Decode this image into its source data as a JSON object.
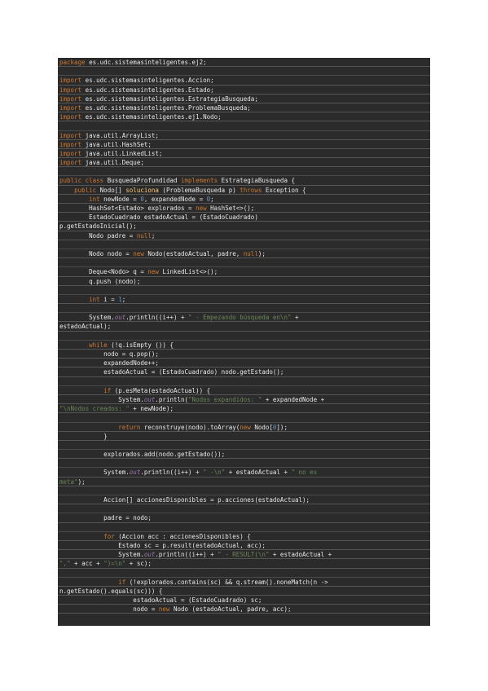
{
  "colors": {
    "background": "#2b2b2b",
    "text": "#e8e8e8",
    "keyword": "#cc7832",
    "number": "#6897bb",
    "string": "#6a8759",
    "method": "#ffc66d",
    "static_field": "#9876aa"
  },
  "code": {
    "lines": [
      [
        [
          "kw",
          "package"
        ],
        [
          "txt",
          " es.udc.sistemasinteligentes.ej2;"
        ]
      ],
      [],
      [
        [
          "kw",
          "import"
        ],
        [
          "txt",
          " es.udc.sistemasinteligentes.Accion;"
        ]
      ],
      [
        [
          "kw",
          "import"
        ],
        [
          "txt",
          " es.udc.sistemasinteligentes.Estado;"
        ]
      ],
      [
        [
          "kw",
          "import"
        ],
        [
          "txt",
          " es.udc.sistemasinteligentes.EstrategiaBusqueda;"
        ]
      ],
      [
        [
          "kw",
          "import"
        ],
        [
          "txt",
          " es.udc.sistemasinteligentes.ProblemaBusqueda;"
        ]
      ],
      [
        [
          "kw",
          "import"
        ],
        [
          "txt",
          " es.udc.sistemasinteligentes.ej1.Nodo;"
        ]
      ],
      [],
      [
        [
          "kw",
          "import"
        ],
        [
          "txt",
          " java.util.ArrayList;"
        ]
      ],
      [
        [
          "kw",
          "import"
        ],
        [
          "txt",
          " java.util.HashSet;"
        ]
      ],
      [
        [
          "kw",
          "import"
        ],
        [
          "txt",
          " java.util.LinkedList;"
        ]
      ],
      [
        [
          "kw",
          "import"
        ],
        [
          "txt",
          " java.util.Deque;"
        ]
      ],
      [],
      [
        [
          "kw",
          "public class"
        ],
        [
          "txt",
          " BusquedaProfundidad "
        ],
        [
          "kw",
          "implements"
        ],
        [
          "txt",
          " EstrategiaBusqueda {"
        ]
      ],
      [
        [
          "txt",
          "    "
        ],
        [
          "kw",
          "public"
        ],
        [
          "txt",
          " Nodo[] "
        ],
        [
          "fn",
          "soluciona"
        ],
        [
          "txt",
          " (ProblemaBusqueda p) "
        ],
        [
          "kw",
          "throws"
        ],
        [
          "txt",
          " Exception {"
        ]
      ],
      [
        [
          "txt",
          "        "
        ],
        [
          "kw",
          "int"
        ],
        [
          "txt",
          " newNode = "
        ],
        [
          "num",
          "0"
        ],
        [
          "txt",
          ", expandedNode = "
        ],
        [
          "num",
          "0"
        ],
        [
          "txt",
          ";"
        ]
      ],
      [
        [
          "txt",
          "        HashSet<Estado> explorados = "
        ],
        [
          "kw",
          "new"
        ],
        [
          "txt",
          " HashSet<>();"
        ]
      ],
      [
        [
          "txt",
          "        EstadoCuadrado estadoActual = (EstadoCuadrado)"
        ]
      ],
      [
        [
          "txt",
          "p.getEstadoInicial();"
        ]
      ],
      [
        [
          "txt",
          "        Nodo padre = "
        ],
        [
          "kw",
          "null"
        ],
        [
          "txt",
          ";"
        ]
      ],
      [],
      [
        [
          "txt",
          "        Nodo nodo = "
        ],
        [
          "kw",
          "new"
        ],
        [
          "txt",
          " Nodo(estadoActual, padre, "
        ],
        [
          "kw",
          "null"
        ],
        [
          "txt",
          ");"
        ]
      ],
      [],
      [
        [
          "txt",
          "        Deque<Nodo> q = "
        ],
        [
          "kw",
          "new"
        ],
        [
          "txt",
          " LinkedList<>();"
        ]
      ],
      [
        [
          "txt",
          "        q.push (nodo);"
        ]
      ],
      [],
      [
        [
          "txt",
          "        "
        ],
        [
          "kw",
          "int"
        ],
        [
          "txt",
          " i = "
        ],
        [
          "num",
          "1"
        ],
        [
          "txt",
          ";"
        ]
      ],
      [],
      [
        [
          "txt",
          "        System."
        ],
        [
          "fld",
          "out"
        ],
        [
          "txt",
          ".println((i++) + "
        ],
        [
          "str",
          "\" - Empezando búsqueda en\\n\""
        ],
        [
          "txt",
          " +"
        ]
      ],
      [
        [
          "txt",
          "estadoActual);"
        ]
      ],
      [],
      [
        [
          "txt",
          "        "
        ],
        [
          "kw",
          "while"
        ],
        [
          "txt",
          " (!q.isEmpty ()) {"
        ]
      ],
      [
        [
          "txt",
          "            nodo = q.pop();"
        ]
      ],
      [
        [
          "txt",
          "            expandedNode++;"
        ]
      ],
      [
        [
          "txt",
          "            estadoActual = (EstadoCuadrado) nodo.getEstado();"
        ]
      ],
      [],
      [
        [
          "txt",
          "            "
        ],
        [
          "kw",
          "if"
        ],
        [
          "txt",
          " (p.esMeta(estadoActual)) {"
        ]
      ],
      [
        [
          "txt",
          "                System."
        ],
        [
          "fld",
          "out"
        ],
        [
          "txt",
          ".println("
        ],
        [
          "str",
          "\"Nodos expandidos: \""
        ],
        [
          "txt",
          " + expandedNode +"
        ]
      ],
      [
        [
          "str",
          "\"\\nNodos creados: \""
        ],
        [
          "txt",
          " + newNode);"
        ]
      ],
      [],
      [
        [
          "txt",
          "                "
        ],
        [
          "kw",
          "return"
        ],
        [
          "txt",
          " reconstruye(nodo).toArray("
        ],
        [
          "kw",
          "new"
        ],
        [
          "txt",
          " Nodo["
        ],
        [
          "num",
          "0"
        ],
        [
          "txt",
          "]);"
        ]
      ],
      [
        [
          "txt",
          "            }"
        ]
      ],
      [],
      [
        [
          "txt",
          "            explorados.add(nodo.getEstado());"
        ]
      ],
      [],
      [
        [
          "txt",
          "            System."
        ],
        [
          "fld",
          "out"
        ],
        [
          "txt",
          ".println((i++) + "
        ],
        [
          "str",
          "\" -\\n\""
        ],
        [
          "txt",
          " + estadoActual + "
        ],
        [
          "str",
          "\" no es"
        ]
      ],
      [
        [
          "str",
          "meta\""
        ],
        [
          "txt",
          ");"
        ]
      ],
      [],
      [
        [
          "txt",
          "            Accion[] accionesDisponibles = p.acciones(estadoActual);"
        ]
      ],
      [],
      [
        [
          "txt",
          "            padre = nodo;"
        ]
      ],
      [],
      [
        [
          "txt",
          "            "
        ],
        [
          "kw",
          "for"
        ],
        [
          "txt",
          " (Accion acc : accionesDisponibles) {"
        ]
      ],
      [
        [
          "txt",
          "                Estado sc = p.result(estadoActual, acc);"
        ]
      ],
      [
        [
          "txt",
          "                System."
        ],
        [
          "fld",
          "out"
        ],
        [
          "txt",
          ".println((i++) + "
        ],
        [
          "str",
          "\" - RESULT(\\n\""
        ],
        [
          "txt",
          " + estadoActual +"
        ]
      ],
      [
        [
          "str",
          "\",\""
        ],
        [
          "txt",
          " + acc + "
        ],
        [
          "str",
          "\")=\\n\""
        ],
        [
          "txt",
          " + sc);"
        ]
      ],
      [],
      [
        [
          "txt",
          "                "
        ],
        [
          "kw",
          "if"
        ],
        [
          "txt",
          " (!explorados.contains(sc) && q.stream().noneMatch(n ->"
        ]
      ],
      [
        [
          "txt",
          "n.getEstado().equals(sc))) {"
        ]
      ],
      [
        [
          "txt",
          "                    estadoActual = (EstadoCuadrado) sc;"
        ]
      ],
      [
        [
          "txt",
          "                    nodo = "
        ],
        [
          "kw",
          "new"
        ],
        [
          "txt",
          " Nodo (estadoActual, padre, acc);"
        ]
      ]
    ]
  }
}
